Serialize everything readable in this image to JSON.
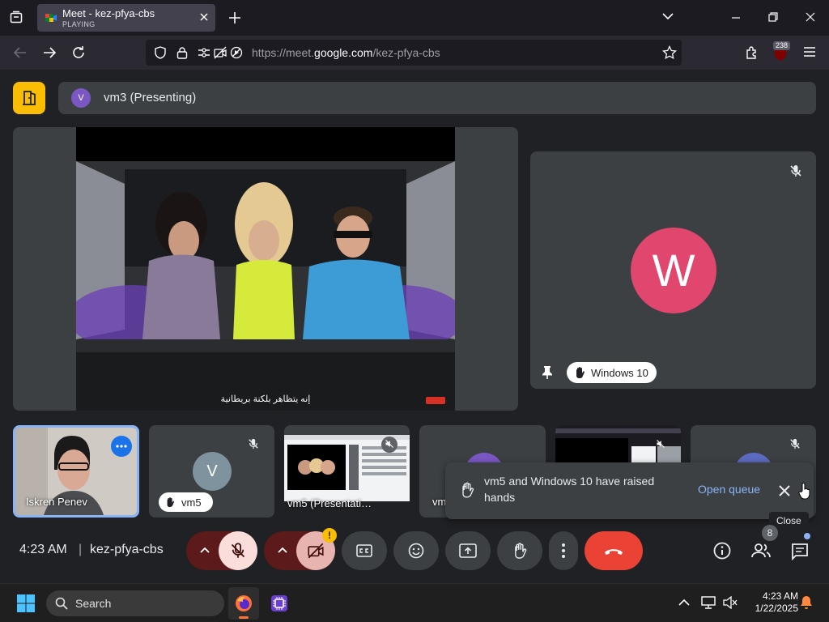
{
  "browser": {
    "tab_title": "Meet - kez-pfya-cbs",
    "tab_status": "PLAYING",
    "url_prefix": "https://meet.",
    "url_domain": "google.com",
    "url_path": "/kez-pfya-cbs",
    "extensions_badge": "238"
  },
  "meet": {
    "presenter_initial": "V",
    "presenter_label": "vm3 (Presenting)",
    "video_subtitle": "إنه يتظاهر بلكنة بريطانية",
    "main_tile": {
      "initial": "W",
      "name": "Windows 10"
    },
    "thumbnails": [
      {
        "name": "Iskren Penev"
      },
      {
        "initial": "V",
        "name": "vm5"
      },
      {
        "name": "vm5 (Presentati…"
      },
      {
        "name": "vm"
      },
      {
        "name": ""
      },
      {
        "name": ""
      }
    ],
    "notification": {
      "text": "vm5 and Windows 10 have raised hands",
      "action": "Open queue",
      "close_tooltip": "Close"
    },
    "time": "4:23 AM",
    "separator": "|",
    "meeting_code": "kez-pfya-cbs",
    "camera_warning": "!",
    "people_count": "8"
  },
  "taskbar": {
    "search_label": "Search",
    "time": "4:23 AM",
    "date": "1/22/2025"
  },
  "colors": {
    "accent_yellow": "#fbbc04",
    "end_call_red": "#ea4335",
    "mic_off_bg": "#f9dedc",
    "link_blue": "#8ab4f8",
    "avatar_pink": "#e0466e",
    "avatar_purple": "#7b57c4"
  }
}
